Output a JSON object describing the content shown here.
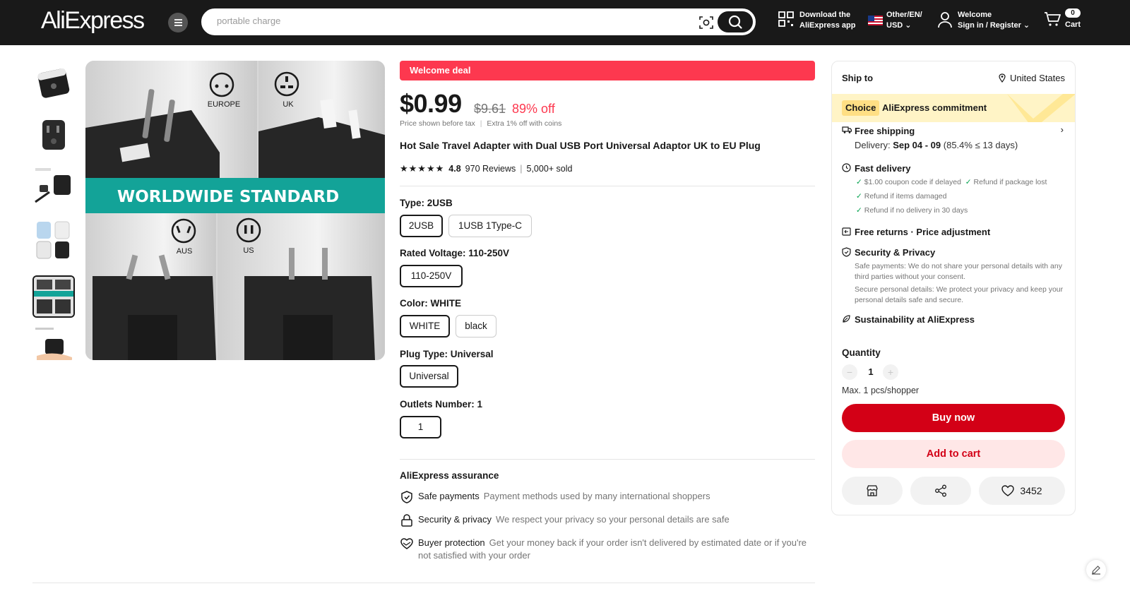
{
  "header": {
    "logo": "AliExpress",
    "search_placeholder": "portable charge",
    "download_line1": "Download the",
    "download_line2": "AliExpress app",
    "locale_line1": "Other/EN/",
    "locale_line2": "USD",
    "account_line1": "Welcome",
    "account_line2": "Sign in / Register",
    "cart_count": "0",
    "cart_label": "Cart"
  },
  "gallery": {
    "image_label_europe": "EUROPE",
    "image_label_uk": "UK",
    "image_banner": "WORLDWIDE STANDARD",
    "image_label_aus": "AUS",
    "image_label_us": "US"
  },
  "product": {
    "welcome_deal": "Welcome deal",
    "price": "$0.99",
    "original_price": "$9.61",
    "discount": "89% off",
    "tax_note": "Price shown before tax",
    "coins_note": "Extra 1% off with coins",
    "title": "Hot Sale Travel Adapter with Dual USB Port Universal Adaptor UK to EU Plug",
    "rating": "4.8",
    "reviews": "970 Reviews",
    "sold": "5,000+ sold",
    "options": {
      "type_label": "Type: 2USB",
      "type_values": [
        "2USB",
        "1USB 1Type-C"
      ],
      "voltage_label": "Rated Voltage: 110-250V",
      "voltage_values": [
        "110-250V"
      ],
      "color_label": "Color: WHITE",
      "color_values": [
        "WHITE",
        "black"
      ],
      "plug_label": "Plug Type: Universal",
      "plug_values": [
        "Universal"
      ],
      "outlets_label": "Outlets Number: 1",
      "outlets_values": [
        "1"
      ]
    },
    "assurance": {
      "title": "AliExpress assurance",
      "items": [
        {
          "key": "Safe payments",
          "value": "Payment methods used by many international shoppers"
        },
        {
          "key": "Security & privacy",
          "value": "We respect your privacy so your personal details are safe"
        },
        {
          "key": "Buyer protection",
          "value": "Get your money back if your order isn't delivered by estimated date or if you're not satisfied with your order"
        }
      ]
    }
  },
  "panel": {
    "ship_to_label": "Ship to",
    "ship_to_value": "United States",
    "choice_tag": "Choice",
    "choice_text": "AliExpress commitment",
    "free_shipping": "Free shipping",
    "delivery_prefix": "Delivery:",
    "delivery_dates": "Sep 04 - 09",
    "delivery_suffix": "(85.4% ≤ 13 days)",
    "fast_delivery": "Fast delivery",
    "fast_items": [
      "$1.00 coupon code if delayed",
      "Refund if package lost",
      "Refund if items damaged",
      "Refund if no delivery in 30 days"
    ],
    "free_returns": "Free returns · Price adjustment",
    "security_title": "Security & Privacy",
    "security_text1": "Safe payments: We do not share your personal details with any third parties without your consent.",
    "security_text2": "Secure personal details: We protect your privacy and keep your personal details safe and secure.",
    "sustainability": "Sustainability at AliExpress",
    "quantity_label": "Quantity",
    "quantity_value": "1",
    "max_note": "Max. 1 pcs/shopper",
    "buy_now": "Buy now",
    "add_to_cart": "Add to cart",
    "wishlist_count": "3452"
  },
  "colors": {
    "header_bg": "#191919",
    "deal_red": "#fd384f",
    "buy_red": "#d30016",
    "choice_yellow": "#fff4c6",
    "banner_teal": "#13a398"
  }
}
